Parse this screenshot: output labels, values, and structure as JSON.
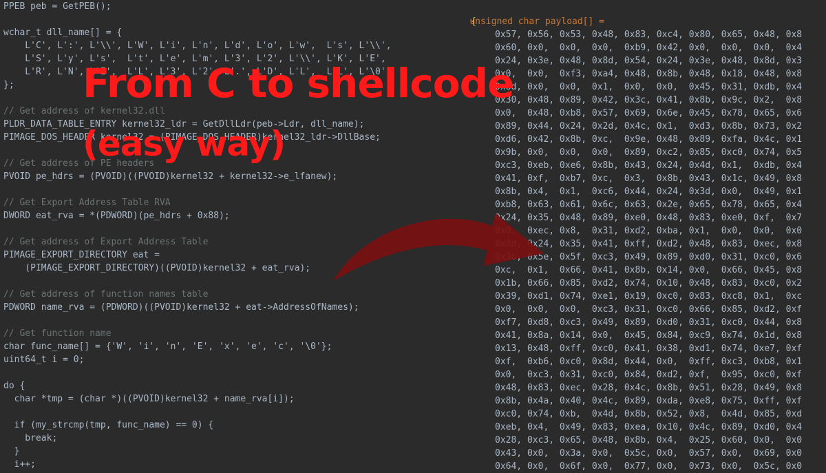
{
  "overlay": {
    "title": "From C to shellcode",
    "subtitle": "(easy way)"
  },
  "left_code": [
    {
      "k": "code",
      "t": "PPEB peb = GetPEB();"
    },
    {
      "k": "blank",
      "t": ""
    },
    {
      "k": "code",
      "t": "wchar_t dll_name[] = {"
    },
    {
      "k": "code",
      "t": "    L'C', L':', L'\\\\', L'W', L'i', L'n', L'd', L'o', L'w',  L's', L'\\\\',"
    },
    {
      "k": "code",
      "t": "    L'S', L'y', L's',  L't', L'e', L'm', L'3', L'2', L'\\\\', L'K', L'E',"
    },
    {
      "k": "code",
      "t": "    L'R', L'N', L'E',  L'L', L'3', L'2', L'.', L'D', L'L',  L'L', L'\\0',"
    },
    {
      "k": "code",
      "t": "};"
    },
    {
      "k": "blank",
      "t": ""
    },
    {
      "k": "comment",
      "t": "// Get address of kernel32.dll"
    },
    {
      "k": "code",
      "t": "PLDR_DATA_TABLE_ENTRY kernel32_ldr = GetDllLdr(peb->Ldr, dll_name);"
    },
    {
      "k": "code",
      "t": "PIMAGE_DOS_HEADER kernel32 = (PIMAGE_DOS_HEADER)kernel32_ldr->DllBase;"
    },
    {
      "k": "blank",
      "t": ""
    },
    {
      "k": "comment",
      "t": "// Get address of PE headers"
    },
    {
      "k": "code",
      "t": "PVOID pe_hdrs = (PVOID)((PVOID)kernel32 + kernel32->e_lfanew);"
    },
    {
      "k": "blank",
      "t": ""
    },
    {
      "k": "comment",
      "t": "// Get Export Address Table RVA"
    },
    {
      "k": "code",
      "t": "DWORD eat_rva = *(PDWORD)(pe_hdrs + 0x88);"
    },
    {
      "k": "blank",
      "t": ""
    },
    {
      "k": "comment",
      "t": "// Get address of Export Address Table"
    },
    {
      "k": "code",
      "t": "PIMAGE_EXPORT_DIRECTORY eat ="
    },
    {
      "k": "code",
      "t": "    (PIMAGE_EXPORT_DIRECTORY)((PVOID)kernel32 + eat_rva);"
    },
    {
      "k": "blank",
      "t": ""
    },
    {
      "k": "comment",
      "t": "// Get address of function names table"
    },
    {
      "k": "code",
      "t": "PDWORD name_rva = (PDWORD)((PVOID)kernel32 + eat->AddressOfNames);"
    },
    {
      "k": "blank",
      "t": ""
    },
    {
      "k": "comment",
      "t": "// Get function name"
    },
    {
      "k": "code",
      "t": "char func_name[] = {'W', 'i', 'n', 'E', 'x', 'e', 'c', '\\0'};"
    },
    {
      "k": "code",
      "t": "uint64_t i = 0;"
    },
    {
      "k": "blank",
      "t": ""
    },
    {
      "k": "code",
      "t": "do {"
    },
    {
      "k": "code",
      "t": "  char *tmp = (char *)((PVOID)kernel32 + name_rva[i]);"
    },
    {
      "k": "blank",
      "t": ""
    },
    {
      "k": "code",
      "t": "  if (my_strcmp(tmp, func_name) == 0) {"
    },
    {
      "k": "code",
      "t": "    break;"
    },
    {
      "k": "code",
      "t": "  }"
    },
    {
      "k": "code",
      "t": "  i++;"
    }
  ],
  "payload_header": "unsigned char payload[] =",
  "payload_open": "{",
  "payload_rows": [
    "0x57, 0x56, 0x53, 0x48, 0x83, 0xc4, 0x80, 0x65, 0x48, 0x8",
    "0x60, 0x0,  0x0,  0x0,  0xb9, 0x42, 0x0,  0x0,  0x0,  0x4",
    "0x24, 0x3e, 0x48, 0x8d, 0x54, 0x24, 0x3e, 0x48, 0x8d, 0x3",
    "0x0,  0x0,  0xf3, 0xa4, 0x48, 0x8b, 0x48, 0x18, 0x48, 0x8",
    "0x8d, 0x0,  0x0,  0x1,  0x0,  0x0,  0x45, 0x31, 0xdb, 0x4",
    "0x30, 0x48, 0x89, 0x42, 0x3c, 0x41, 0x8b, 0x9c, 0x2,  0x8",
    "0x0,  0x48, 0xb8, 0x57, 0x69, 0x6e, 0x45, 0x78, 0x65, 0x6",
    "0x89, 0x44, 0x24, 0x2d, 0x4c, 0x1,  0xd3, 0x8b, 0x73, 0x2",
    "0xd6, 0x42, 0x8b, 0xc,  0x9e, 0x48, 0x89, 0xfa, 0x4c, 0x1",
    "0x9b, 0x0,  0x0,  0x0,  0x89, 0xc2, 0x85, 0xc0, 0x74, 0x5",
    "0xc3, 0xeb, 0xe6, 0x8b, 0x43, 0x24, 0x4d, 0x1,  0xdb, 0x4",
    "0x41, 0xf,  0xb7, 0xc,  0x3,  0x8b, 0x43, 0x1c, 0x49, 0x8",
    "0x8b, 0x4,  0x1,  0xc6, 0x44, 0x24, 0x3d, 0x0,  0x49, 0x1",
    "0xb8, 0x63, 0x61, 0x6c, 0x63, 0x2e, 0x65, 0x78, 0x65, 0x4",
    "0x24, 0x35, 0x48, 0x89, 0xe0, 0x48, 0x83, 0xe0, 0xf,  0x7",
    "0x0,  0xec, 0x8,  0x31, 0xd2, 0xba, 0x1,  0x0,  0x0,  0x0",
    "0x8d, 0x24, 0x35, 0x41, 0xff, 0xd2, 0x48, 0x83, 0xec, 0x8",
    "0x3b, 0x5e, 0x5f, 0xc3, 0x49, 0x89, 0xd0, 0x31, 0xc0, 0x6",
    "0xc,  0x1,  0x66, 0x41, 0x8b, 0x14, 0x0,  0x66, 0x45, 0x8",
    "0x1b, 0x66, 0x85, 0xd2, 0x74, 0x10, 0x48, 0x83, 0xc0, 0x2",
    "0x39, 0xd1, 0x74, 0xe1, 0x19, 0xc0, 0x83, 0xc8, 0x1,  0xc",
    "0x0,  0x0,  0x0,  0xc3, 0x31, 0xc0, 0x66, 0x85, 0xd2, 0xf",
    "0xf7, 0xd8, 0xc3, 0x49, 0x89, 0xd0, 0x31, 0xc0, 0x44, 0x8",
    "0x41, 0x8a, 0x14, 0x0,  0x45, 0x84, 0xc9, 0x74, 0x1d, 0x8",
    "0x13, 0x48, 0xff, 0xc0, 0x41, 0x38, 0xd1, 0x74, 0xe7, 0xf",
    "0xf,  0xb6, 0xc0, 0x8d, 0x44, 0x0,  0xff, 0xc3, 0xb8, 0x1",
    "0x0,  0xc3, 0x31, 0xc0, 0x84, 0xd2, 0xf,  0x95, 0xc0, 0xf",
    "0x48, 0x83, 0xec, 0x28, 0x4c, 0x8b, 0x51, 0x28, 0x49, 0x8",
    "0x8b, 0x4a, 0x40, 0x4c, 0x89, 0xda, 0xe8, 0x75, 0xff, 0xf",
    "0xc0, 0x74, 0xb,  0x4d, 0x8b, 0x52, 0x8,  0x4d, 0x85, 0xd",
    "0xeb, 0x4,  0x49, 0x83, 0xea, 0x10, 0x4c, 0x89, 0xd0, 0x4",
    "0x28, 0xc3, 0x65, 0x48, 0x8b, 0x4,  0x25, 0x60, 0x0,  0x0",
    "0x43, 0x0,  0x3a, 0x0,  0x5c, 0x0,  0x57, 0x0,  0x69, 0x0",
    "0x64, 0x0,  0x6f, 0x0,  0x77, 0x0,  0x73, 0x0,  0x5c, 0x0"
  ],
  "colors": {
    "background": "#2b2b2b",
    "text": "#a9b7c6",
    "keyword": "#cc7832",
    "comment": "#6b7373",
    "overlay_red": "#ff1a1a",
    "arrow": "#7a1010"
  }
}
